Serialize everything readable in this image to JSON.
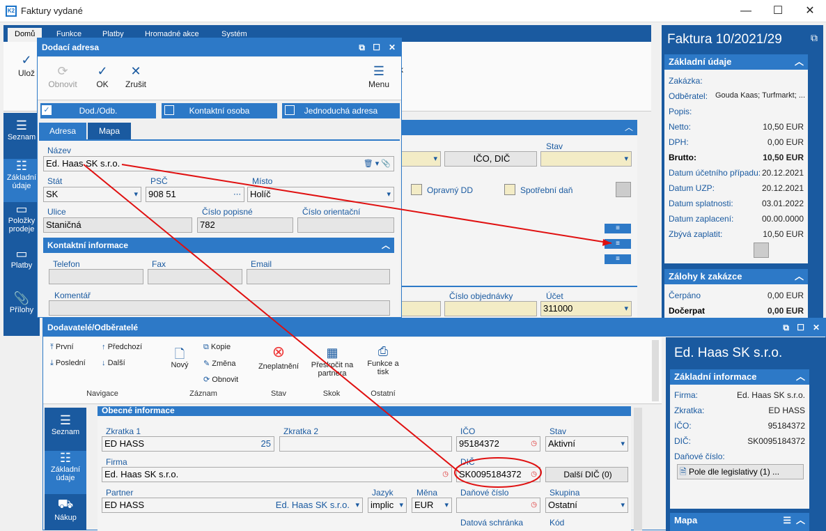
{
  "window": {
    "title": "Faktury vydané",
    "app_icon": "K2"
  },
  "main_tabs": [
    "Domů",
    "Funkce",
    "Platby",
    "Hromadné akce",
    "Systém"
  ],
  "ribbon": {
    "save_label": "Ulož",
    "right_hint": "k"
  },
  "left_nav": [
    {
      "label": "Seznam"
    },
    {
      "label": "Základní údaje"
    },
    {
      "label": "Položky prodeje"
    },
    {
      "label": "Platby"
    },
    {
      "label": "Přílohy"
    }
  ],
  "right_panel": {
    "title": "Faktura 10/2021/29",
    "zakladni_title": "Základní údaje",
    "rows": [
      {
        "k": "Zakázka:",
        "v": ""
      },
      {
        "k": "Odběratel:",
        "v": "Gouda Kaas; Turfmarkt; ..."
      },
      {
        "k": "Popis:",
        "v": ""
      },
      {
        "k": "Netto:",
        "v": "10,50 EUR"
      },
      {
        "k": "DPH:",
        "v": "0,00 EUR"
      },
      {
        "k": "Brutto:",
        "v": "10,50 EUR"
      },
      {
        "k": "Datum účetního případu:",
        "v": "20.12.2021"
      },
      {
        "k": "Datum UZP:",
        "v": "20.12.2021"
      },
      {
        "k": "Datum splatnosti:",
        "v": "03.01.2022"
      },
      {
        "k": "Datum zaplacení:",
        "v": "00.00.0000"
      },
      {
        "k": "Zbývá zaplatit:",
        "v": "10,50 EUR"
      }
    ],
    "zalohy_title": "Zálohy k zakázce",
    "zalohy": [
      {
        "k": "Čerpáno",
        "v": "0,00 EUR"
      },
      {
        "k": "Dočerpat",
        "v": "0,00 EUR"
      }
    ]
  },
  "bg_form": {
    "ico_dic": "IČO, DIČ",
    "stav": "Stav",
    "opravny": "Opravný DD",
    "spotrebni": "Spotřební daň",
    "cislo_obj": "Číslo objednávky",
    "ucet_lbl": "Účet",
    "ucet": "311000"
  },
  "dodaci": {
    "title": "Dodací adresa",
    "toolbar": {
      "refresh": "Obnovit",
      "ok": "OK",
      "cancel": "Zrušit",
      "menu": "Menu"
    },
    "checks": [
      "Dod./Odb.",
      "Kontaktní osoba",
      "Jednoduchá adresa"
    ],
    "tabs": [
      "Adresa",
      "Mapa"
    ],
    "nazev_lbl": "Název",
    "nazev": "Ed. Haas SK s.r.o.",
    "stat_lbl": "Stát",
    "stat": "SK",
    "psc_lbl": "PSČ",
    "psc": "908 51",
    "misto_lbl": "Místo",
    "misto": "Holíč",
    "ulice_lbl": "Ulice",
    "ulice": "Staničná",
    "cp_lbl": "Číslo popisné",
    "cp": "782",
    "co_lbl": "Číslo orientační",
    "co": "",
    "kontakt_title": "Kontaktní informace",
    "telefon_lbl": "Telefon",
    "fax_lbl": "Fax",
    "email_lbl": "Email",
    "komentar_lbl": "Komentář"
  },
  "dod": {
    "title": "Dodavatelé/Odběratelé",
    "nav": {
      "prvni": "První",
      "predchozi": "Předchozí",
      "posledni": "Poslední",
      "dalsi": "Další",
      "group": "Navigace"
    },
    "zaznam": {
      "novy": "Nový",
      "kopie": "Kopie",
      "zmena": "Změna",
      "obnovit": "Obnovit",
      "group": "Záznam"
    },
    "stav": {
      "zneplatneni": "Zneplatnění",
      "group": "Stav"
    },
    "skok": {
      "preskocit": "Přeskočit na partnera",
      "group": "Skok"
    },
    "ostatni": {
      "funkce": "Funkce a tisk",
      "group": "Ostatní"
    },
    "left_nav": [
      {
        "label": "Seznam"
      },
      {
        "label": "Základní údaje"
      },
      {
        "label": "Nákup"
      }
    ],
    "section": "Obecné informace",
    "zkratka1_lbl": "Zkratka 1",
    "zkratka1": "ED HASS",
    "zkratka1_num": "25",
    "zkratka2_lbl": "Zkratka 2",
    "ico_lbl": "IČO",
    "ico": "95184372",
    "stav_lbl": "Stav",
    "stav_val": "Aktivní",
    "firma_lbl": "Firma",
    "firma": "Ed. Haas SK s.r.o.",
    "dic_lbl": "DIČ",
    "dic": "SK0095184372",
    "dalsi_dic": "Další DIČ (0)",
    "partner_lbl": "Partner",
    "partner": "ED HASS",
    "partner_name": "Ed. Haas SK s.r.o.",
    "jazyk_lbl": "Jazyk",
    "jazyk": "implic",
    "mena_lbl": "Měna",
    "mena": "EUR",
    "danove_lbl": "Daňové číslo",
    "skupina_lbl": "Skupina",
    "skupina": "Ostatní",
    "datova_lbl": "Datová schránka",
    "kod_lbl": "Kód"
  },
  "dod_right": {
    "title": "Ed. Haas SK s.r.o.",
    "section": "Základní informace",
    "rows": [
      {
        "k": "Firma:",
        "v": "Ed. Haas SK s.r.o."
      },
      {
        "k": "Zkratka:",
        "v": "ED HASS"
      },
      {
        "k": "IČO:",
        "v": "95184372"
      },
      {
        "k": "DIČ:",
        "v": "SK0095184372"
      },
      {
        "k": "Daňové číslo:",
        "v": ""
      }
    ],
    "pole_btn": "Pole dle legislativy (1) ...",
    "mapa": "Mapa"
  },
  "colors": {
    "accent": "#2d79c7",
    "dark": "#1a5aa0",
    "annotation": "#e01010"
  }
}
